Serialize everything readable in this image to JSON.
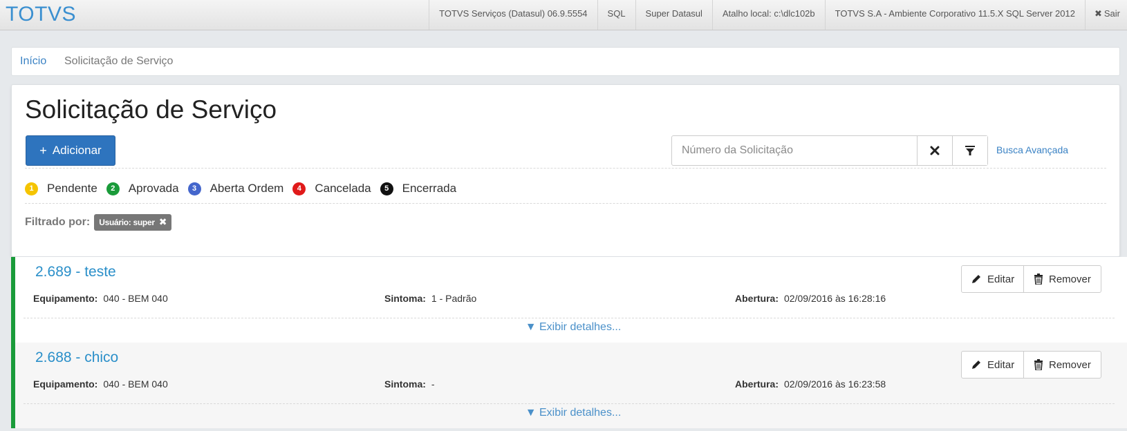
{
  "topbar": {
    "brand": "TOTVS",
    "items": [
      "TOTVS Serviços (Datasul) 06.9.5554",
      "SQL",
      "Super Datasul",
      "Atalho local: c:\\dlc102b",
      "TOTVS S.A - Ambiente Corporativo 11.5.X SQL Server 2012"
    ],
    "logout_label": "Sair"
  },
  "breadcrumb": {
    "home": "Início",
    "current": "Solicitação de Serviço"
  },
  "page": {
    "title": "Solicitação de Serviço",
    "add_label": "Adicionar",
    "search_placeholder": "Número da Solicitação",
    "advanced_search": "Busca Avançada"
  },
  "legend": [
    {
      "num": "1",
      "label": "Pendente",
      "color": "#f5c400"
    },
    {
      "num": "2",
      "label": "Aprovada",
      "color": "#1a9b3a"
    },
    {
      "num": "3",
      "label": "Aberta Ordem",
      "color": "#4466cc"
    },
    {
      "num": "4",
      "label": "Cancelada",
      "color": "#e01a1a"
    },
    {
      "num": "5",
      "label": "Encerrada",
      "color": "#111111"
    }
  ],
  "filter": {
    "label": "Filtrado por:",
    "tag": "Usuário: super"
  },
  "labels": {
    "equipamento": "Equipamento:",
    "sintoma": "Sintoma:",
    "abertura": "Abertura:",
    "edit": "Editar",
    "remove": "Remover",
    "details": "▼ Exibir detalhes..."
  },
  "requests": [
    {
      "title": "2.689 - teste",
      "equipamento": "040 - BEM 040",
      "sintoma": "1 - Padrão",
      "abertura": "02/09/2016 às 16:28:16",
      "background": "#ffffff"
    },
    {
      "title": "2.688 - chico",
      "equipamento": "040 - BEM 040",
      "sintoma": "-",
      "abertura": "02/09/2016 às 16:23:58",
      "background": "#f6f6f6"
    }
  ]
}
